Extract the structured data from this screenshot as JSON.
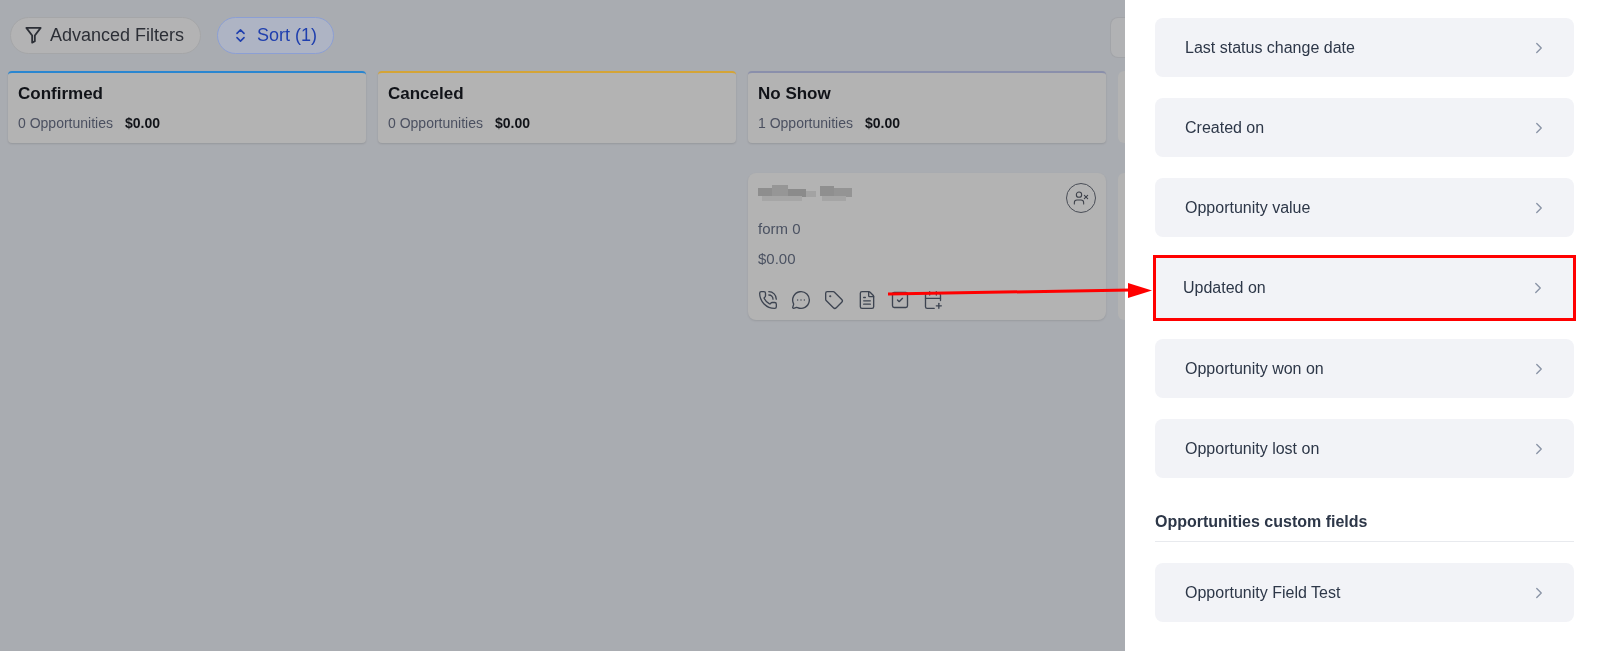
{
  "toolbar": {
    "buttons": [
      {
        "kind": "filter",
        "label": "Advanced Filters",
        "active": false
      },
      {
        "kind": "sort",
        "label": "Sort (1)",
        "active": true
      }
    ]
  },
  "columns": [
    {
      "name": "Confirmed",
      "count": "0 Opportunities",
      "value": "$0.00",
      "color": "#2a86d0"
    },
    {
      "name": "Canceled",
      "count": "0 Opportunities",
      "value": "$0.00",
      "color": "#d4a437"
    },
    {
      "name": "No Show",
      "count": "1 Opportunities",
      "value": "$0.00",
      "color": "#8a8fab",
      "cards": [
        {
          "subtitle": "form 0",
          "value": "$0.00"
        }
      ]
    }
  ],
  "panel": {
    "sections": [
      {
        "items": [
          {
            "label": "Last status change date",
            "highlighted": false
          },
          {
            "label": "Created on",
            "highlighted": false
          },
          {
            "label": "Opportunity value",
            "highlighted": false
          },
          {
            "label": "Updated on",
            "highlighted": true
          },
          {
            "label": "Opportunity won on",
            "highlighted": false
          },
          {
            "label": "Opportunity lost on",
            "highlighted": false
          }
        ]
      },
      {
        "heading": "Opportunities custom fields",
        "items": [
          {
            "label": "Opportunity Field Test",
            "highlighted": false
          }
        ]
      }
    ]
  },
  "annotation": {
    "kind": "arrow"
  }
}
